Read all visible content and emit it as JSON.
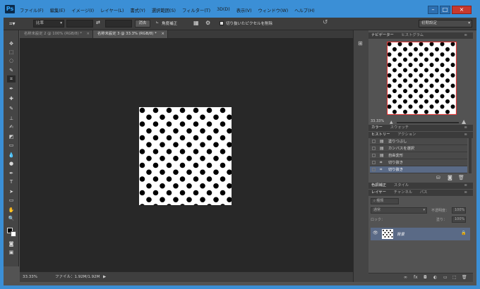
{
  "app": {
    "logo": "Ps",
    "accent_color": "#3b8fd6"
  },
  "menu": [
    "ファイル(F)",
    "編集(E)",
    "イメージ(I)",
    "レイヤー(L)",
    "書式(Y)",
    "選択範囲(S)",
    "フィルター(T)",
    "3D(D)",
    "表示(V)",
    "ウィンドウ(W)",
    "ヘルプ(H)"
  ],
  "window_buttons": {
    "minimize": "–",
    "maximize": "□",
    "close": "×"
  },
  "options": {
    "ratio_select": "比率",
    "clear_button": "消去",
    "straighten_label": "角度補正",
    "delete_cropped": "切り抜いたピクセルを削除",
    "workspace": "初期設定"
  },
  "tabs": [
    {
      "label": "名称未設定 2 @ 100% (RGB/8) *",
      "close": "×"
    },
    {
      "label": "名称未設定 3 @ 33.3% (RGB/8) *",
      "close": "×"
    }
  ],
  "status": {
    "zoom": "33.33%",
    "file": "ファイル：1.92M/1.92M",
    "arrow": "▶"
  },
  "navigator": {
    "tabs": [
      "ナビゲーター",
      "ヒストグラム"
    ],
    "zoom": "33.33%"
  },
  "color_tabs": [
    "カラー",
    "スウォッチ"
  ],
  "history": {
    "tabs": [
      "ヒストリー",
      "アクション"
    ],
    "items": [
      {
        "label": "塗りつぶし",
        "icon": "▤"
      },
      {
        "label": "カンバスを選択",
        "icon": "▤"
      },
      {
        "label": "自由変形",
        "icon": "▤"
      },
      {
        "label": "切り抜き",
        "icon": "⌗"
      },
      {
        "label": "切り抜き",
        "icon": "⌗"
      }
    ]
  },
  "adjust_tabs": [
    "色調補正",
    "スタイル"
  ],
  "layers": {
    "tabs": [
      "レイヤー",
      "チャンネル",
      "パス"
    ],
    "filter": "種類",
    "blend": "通常",
    "opacity_label": "不透明度：",
    "opacity_value": "100%",
    "lock_label": "ロック：",
    "fill_label": "塗り：",
    "fill_value": "100%",
    "layer_name": "背景"
  },
  "colors": {
    "canvas_bg": "#282828",
    "ui_bg": "#535353",
    "selection": "#5a6a86"
  }
}
